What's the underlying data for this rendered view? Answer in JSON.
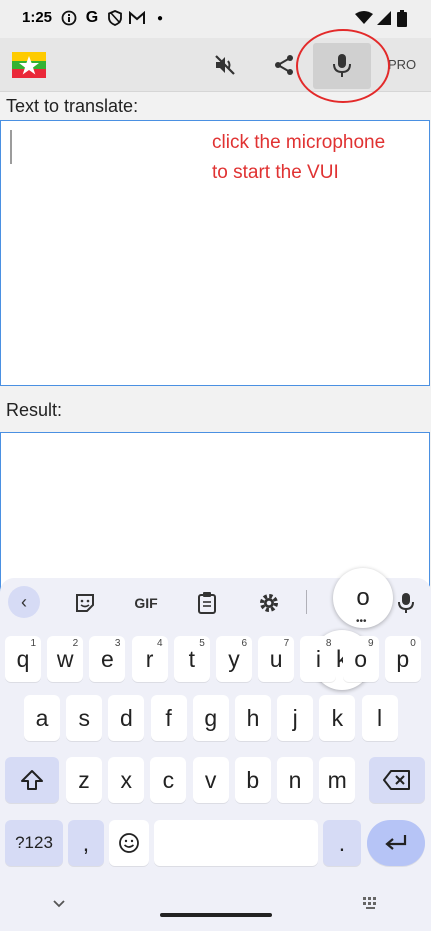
{
  "status_bar": {
    "time": "1:25",
    "icons": [
      "info-icon",
      "google-icon",
      "shield-icon",
      "gmail-icon",
      "dot-icon",
      "wifi-icon",
      "signal-icon",
      "battery-icon"
    ]
  },
  "toolbar": {
    "flag": "myanmar-flag",
    "mute_icon": "volume-off-icon",
    "share_icon": "share-icon",
    "mic_icon": "microphone-icon",
    "pro_label": "PRO",
    "highlight_color": "#e32a2a"
  },
  "source": {
    "label": "Text to translate:",
    "value": "",
    "annotation_line1": "click the microphone",
    "annotation_line2": "to start the VUI"
  },
  "result": {
    "label": "Result:",
    "value": ""
  },
  "keyboard": {
    "toolbar": [
      "back-icon",
      "sticker-icon",
      "GIF",
      "clipboard-icon",
      "gear-icon",
      "microphone-icon"
    ],
    "popup_o": "o",
    "popup_k": "k",
    "row1": [
      {
        "key": "q",
        "hint": "1"
      },
      {
        "key": "w",
        "hint": "2"
      },
      {
        "key": "e",
        "hint": "3"
      },
      {
        "key": "r",
        "hint": "4"
      },
      {
        "key": "t",
        "hint": "5"
      },
      {
        "key": "y",
        "hint": "6"
      },
      {
        "key": "u",
        "hint": "7"
      },
      {
        "key": "i",
        "hint": "8"
      },
      {
        "key": "o",
        "hint": "9"
      },
      {
        "key": "p",
        "hint": "0"
      }
    ],
    "row2": [
      "a",
      "s",
      "d",
      "f",
      "g",
      "h",
      "j",
      "k",
      "l"
    ],
    "row3": [
      "z",
      "x",
      "c",
      "v",
      "b",
      "n",
      "m"
    ],
    "symbols_label": "?123",
    "comma": ",",
    "period": ".",
    "accent_color": "#b6c4f6"
  }
}
